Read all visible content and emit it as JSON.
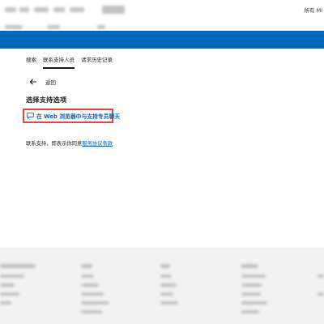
{
  "colors": {
    "brand_blue": "#0067b8",
    "highlight_red": "#e0463d",
    "footer_bg": "#f2f2f2"
  },
  "header": {
    "language_label": "所有 Mi"
  },
  "tabs": [
    {
      "label": "搜索",
      "active": false
    },
    {
      "label": "联系支持人员",
      "active": true
    },
    {
      "label": "请求历史记录",
      "active": false
    }
  ],
  "back": {
    "icon": "arrow-left-icon",
    "label": "返回"
  },
  "section": {
    "title": "选择支持选项"
  },
  "chat_option": {
    "icon": "chat-bubble-icon",
    "label": "在 Web 浏览器中与支持专员聊天"
  },
  "terms": {
    "prefix": "联系支持，即表示你同意",
    "link_label": "服务协议条款"
  }
}
